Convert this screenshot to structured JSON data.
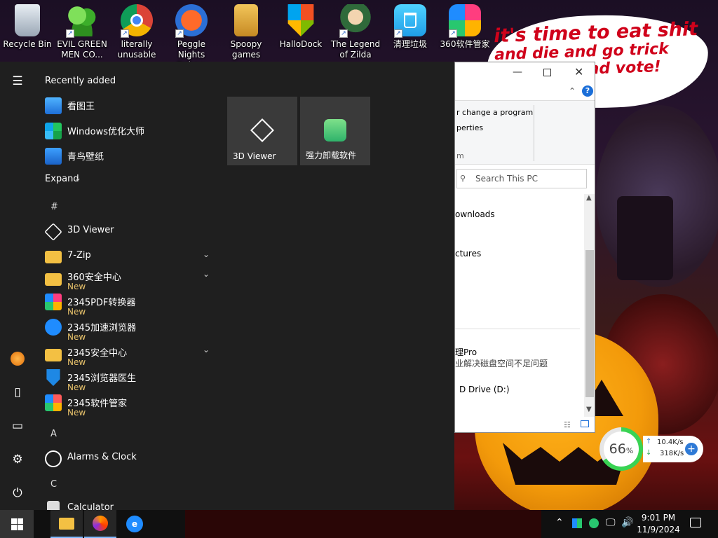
{
  "desktop_icons": [
    {
      "label": "Recycle Bin",
      "icon": "recycle-bin-icon"
    },
    {
      "label": "EVIL GREEN MEN CO...",
      "icon": "people-icon"
    },
    {
      "label": "literally unusable",
      "icon": "chrome-icon"
    },
    {
      "label": "Peggle Nights Deluxe",
      "icon": "peggle-icon"
    },
    {
      "label": "Spoopy games",
      "icon": "folder-icon"
    },
    {
      "label": "HalloDock",
      "icon": "shield-icon"
    },
    {
      "label": "The Legend of Zilda",
      "icon": "game-icon"
    },
    {
      "label": "清理垃圾",
      "icon": "trash-icon"
    },
    {
      "label": "360软件管家",
      "icon": "colorful-cube-icon"
    }
  ],
  "wallpaper": {
    "speech_line1": "it's time to eat shit",
    "speech_line2": "and die and go trick",
    "speech_line3": "and vote!"
  },
  "start_menu": {
    "recently_added_header": "Recently added",
    "recent": [
      {
        "name": "看图王",
        "color": "#2e8fe6"
      },
      {
        "name": "Windows优化大师",
        "color": "#22a36b"
      },
      {
        "name": "青鸟壁纸",
        "color": "#1e7fd9"
      }
    ],
    "expand_label": "Expand",
    "letters": {
      "hash": "#",
      "a": "A",
      "c": "C"
    },
    "apps": [
      {
        "name": "3D Viewer",
        "new": "",
        "chevron": false,
        "icon": "cube-icon"
      },
      {
        "name": "7-Zip",
        "new": "",
        "chevron": true,
        "icon": "folder-icon"
      },
      {
        "name": "360安全中心",
        "new": "New",
        "chevron": true,
        "icon": "folder-icon"
      },
      {
        "name": "2345PDF转换器",
        "new": "New",
        "chevron": false,
        "icon": "pdf-icon"
      },
      {
        "name": "2345加速浏览器",
        "new": "New",
        "chevron": false,
        "icon": "browser-icon"
      },
      {
        "name": "2345安全中心",
        "new": "New",
        "chevron": true,
        "icon": "folder-icon"
      },
      {
        "name": "2345浏览器医生",
        "new": "New",
        "chevron": false,
        "icon": "shield-plus-icon"
      },
      {
        "name": "2345软件管家",
        "new": "New",
        "chevron": false,
        "icon": "grid-icon"
      },
      {
        "name": "Alarms & Clock",
        "new": "",
        "chevron": false,
        "icon": "clock-icon"
      },
      {
        "name": "Calculator",
        "new": "",
        "chevron": false,
        "icon": "calculator-icon"
      }
    ],
    "tiles": [
      {
        "label": "3D Viewer",
        "icon": "cube-icon"
      },
      {
        "label": "强力卸载软件",
        "icon": "uninstall-icon"
      }
    ]
  },
  "explorer": {
    "ribbon_item1": "r change a program",
    "ribbon_item2": "perties",
    "ribbon_item3": "m",
    "search_placeholder": "Search This PC",
    "items": [
      "ownloads",
      "ctures"
    ],
    "drive_name": "理Pro",
    "drive_desc": "业解决磁盘空间不足问题",
    "drive_d": "D Drive (D:)"
  },
  "widget": {
    "percent": "66",
    "percent_unit": "%",
    "up_speed": "10.4K/s",
    "down_speed": "318K/s"
  },
  "taskbar": {
    "time": "9:01 PM",
    "date": "11/9/2024"
  }
}
